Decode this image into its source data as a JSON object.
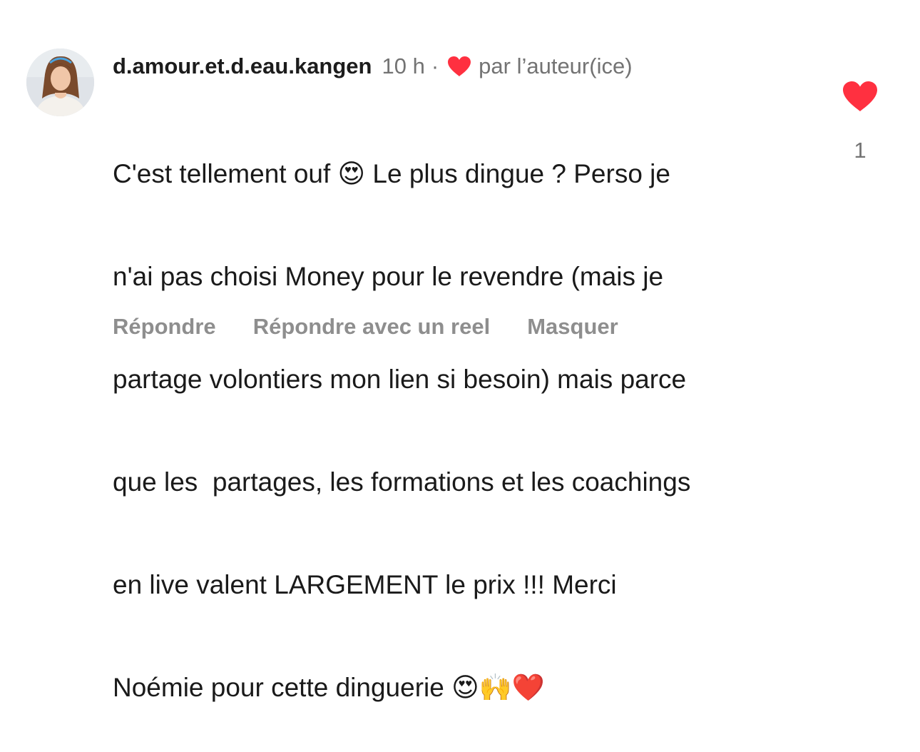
{
  "comment": {
    "username": "d.amour.et.d.eau.kangen",
    "time": "10 h",
    "separator": "·",
    "liked_by_author_label": "par l’auteur(ice)",
    "text_lines": [
      "C'est tellement ouf 😍 Le plus dingue ? Perso je",
      "n'ai pas choisi Money pour le revendre (mais je",
      "partage volontiers mon lien si besoin) mais parce",
      "que les  partages, les formations et les coachings",
      "en live valent LARGEMENT le prix !!! Merci",
      "Noémie pour cette dinguerie 😍🙌❤️"
    ],
    "like_count": "1",
    "like_icon": "heart-filled-icon",
    "like_color": "#ff3040"
  },
  "actions": {
    "reply_label": "Répondre",
    "reply_reel_label": "Répondre avec un reel",
    "hide_label": "Masquer"
  },
  "colors": {
    "username": "#1c1c1c",
    "meta": "#737373",
    "actions": "#8e8e8e",
    "heart": "#ff3040"
  }
}
